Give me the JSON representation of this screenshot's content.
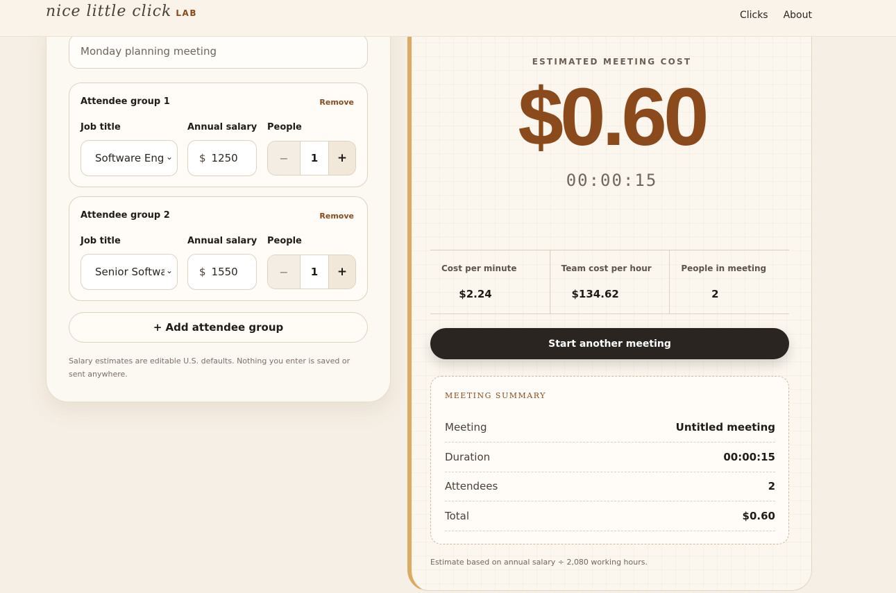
{
  "header": {
    "logo_text": "nice little click",
    "logo_suffix": "LAB",
    "nav": [
      "Clicks",
      "About"
    ]
  },
  "form": {
    "meeting_name_placeholder": "Monday planning meeting",
    "groups": [
      {
        "title": "Attendee group 1",
        "remove_label": "Remove",
        "job_title_label": "Job title",
        "salary_label": "Annual salary",
        "people_label": "People",
        "job_title_value": "Software Engineer",
        "currency": "$",
        "salary_value": "1250",
        "people_count": "1"
      },
      {
        "title": "Attendee group 2",
        "remove_label": "Remove",
        "job_title_label": "Job title",
        "salary_label": "Annual salary",
        "people_label": "People",
        "job_title_value": "Senior Software Engineer",
        "currency": "$",
        "salary_value": "1550",
        "people_count": "1"
      }
    ],
    "stepper_minus": "−",
    "stepper_plus": "+",
    "add_group_label": "+ Add attendee group",
    "disclaimer": "Salary estimates are editable U.S. defaults. Nothing you enter is saved or sent anywhere."
  },
  "results": {
    "label": "ESTIMATED MEETING COST",
    "cost": "$0.60",
    "timer": "00:00:15",
    "stats": [
      {
        "label": "Cost per minute",
        "value": "$2.24"
      },
      {
        "label": "Team cost per hour",
        "value": "$134.62"
      },
      {
        "label": "People in meeting",
        "value": "2"
      }
    ],
    "start_button": "Start another meeting",
    "summary": {
      "title": "MEETING SUMMARY",
      "rows": [
        {
          "label": "Meeting",
          "value": "Untitled meeting"
        },
        {
          "label": "Duration",
          "value": "00:00:15"
        },
        {
          "label": "Attendees",
          "value": "2"
        },
        {
          "label": "Total",
          "value": "$0.60"
        }
      ]
    },
    "footnote": "Estimate based on annual salary ÷ 2,080 working hours."
  },
  "colors": {
    "accent": "#8b4a1c",
    "card_border_accent": "#dcab62",
    "button_dark": "#2a2520",
    "background": "#f6efe5"
  }
}
